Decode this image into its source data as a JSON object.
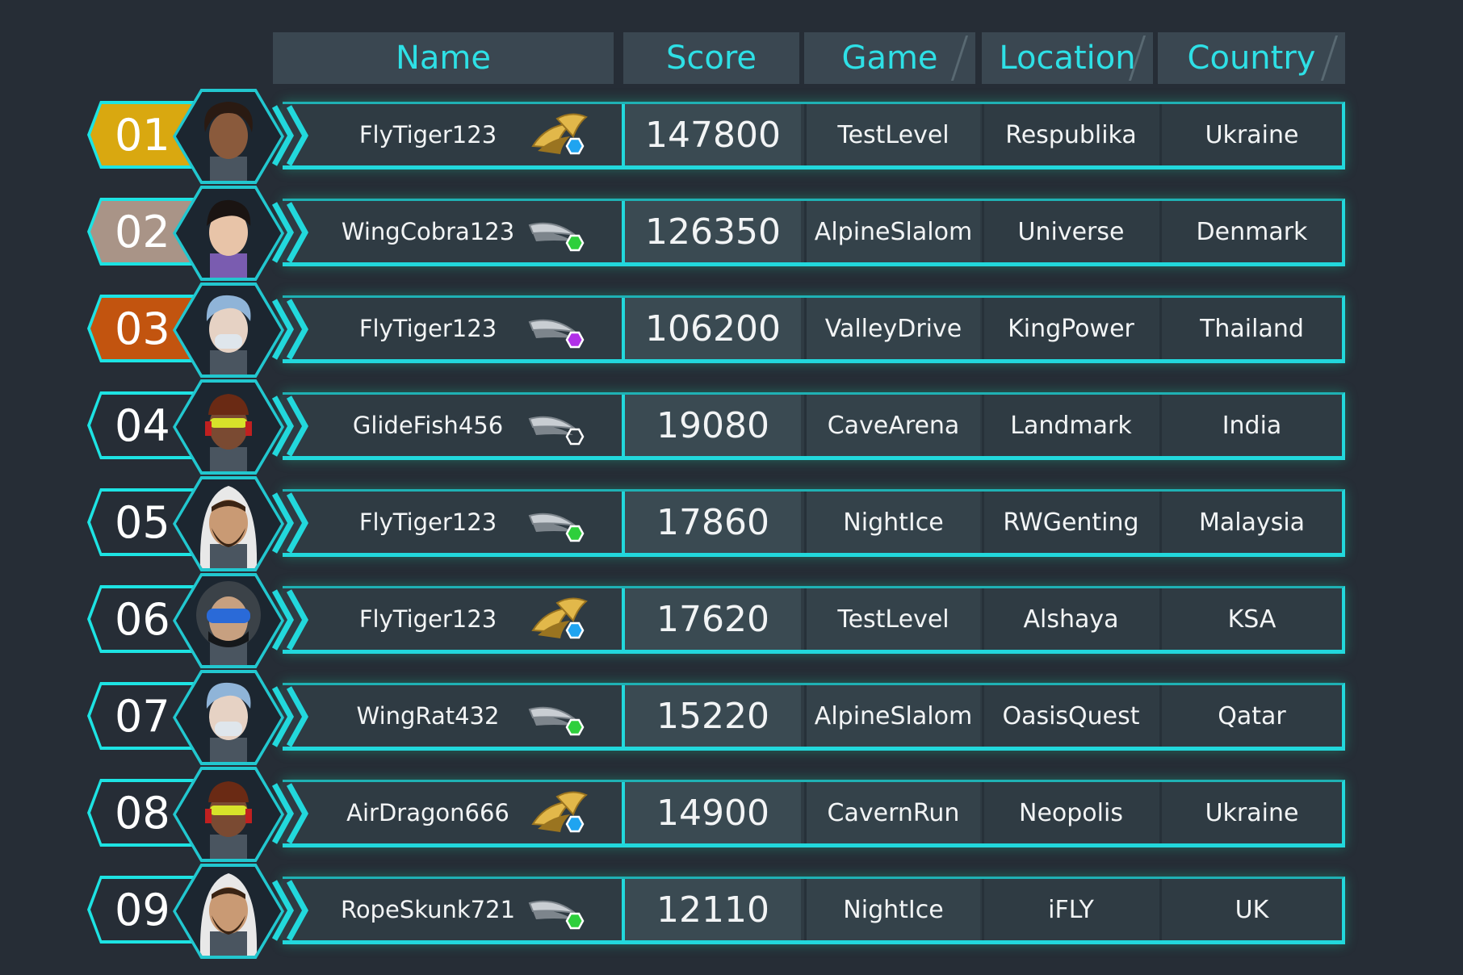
{
  "header": {
    "name": "Name",
    "score": "Score",
    "game": "Game",
    "location": "Location",
    "country": "Country"
  },
  "rows": [
    {
      "rank": "01",
      "tier": "gold",
      "name": "FlyTiger123",
      "score": "147800",
      "game": "TestLevel",
      "location": "Respublika",
      "country": "Ukraine",
      "badge": "gold-wings-blue-gem",
      "avatar": "curly-hair-child"
    },
    {
      "rank": "02",
      "tier": "silver",
      "name": "WingCobra123",
      "score": "126350",
      "game": "AlpineSlalom",
      "location": "Universe",
      "country": "Denmark",
      "badge": "silver-wings-green-gem",
      "avatar": "dark-hair-youth"
    },
    {
      "rank": "03",
      "tier": "bronze",
      "name": "FlyTiger123",
      "score": "106200",
      "game": "ValleyDrive",
      "location": "KingPower",
      "country": "Thailand",
      "badge": "silver-wings-purple-gem",
      "avatar": "masked-blue-hair"
    },
    {
      "rank": "04",
      "tier": "plain",
      "name": "GlideFish456",
      "score": "19080",
      "game": "CaveArena",
      "location": "Landmark",
      "country": "India",
      "badge": "silver-wings-empty-gem",
      "avatar": "goggles-headphones"
    },
    {
      "rank": "05",
      "tier": "plain",
      "name": "FlyTiger123",
      "score": "17860",
      "game": "NightIce",
      "location": "RWGenting",
      "country": "Malaysia",
      "badge": "silver-wings-green-gem",
      "avatar": "bearded-hood"
    },
    {
      "rank": "06",
      "tier": "plain",
      "name": "FlyTiger123",
      "score": "17620",
      "game": "TestLevel",
      "location": "Alshaya",
      "country": "KSA",
      "badge": "gold-wings-blue-gem",
      "avatar": "helmet-visor"
    },
    {
      "rank": "07",
      "tier": "plain",
      "name": "WingRat432",
      "score": "15220",
      "game": "AlpineSlalom",
      "location": "OasisQuest",
      "country": "Qatar",
      "badge": "silver-wings-green-gem",
      "avatar": "masked-blue-hair"
    },
    {
      "rank": "08",
      "tier": "plain",
      "name": "AirDragon666",
      "score": "14900",
      "game": "CavernRun",
      "location": "Neopolis",
      "country": "Ukraine",
      "badge": "gold-wings-blue-gem",
      "avatar": "goggles-headphones"
    },
    {
      "rank": "09",
      "tier": "plain",
      "name": "RopeSkunk721",
      "score": "12110",
      "game": "NightIce",
      "location": "iFLY",
      "country": "UK",
      "badge": "silver-wings-green-gem",
      "avatar": "bearded-hood"
    }
  ],
  "colors": {
    "accent": "#22d8dc",
    "gold": "#d9a810",
    "silver": "#a99487",
    "bronze": "#c2540f",
    "gem_blue": "#1fa4f0",
    "gem_green": "#2ecf3c",
    "gem_purple": "#b130e8"
  }
}
